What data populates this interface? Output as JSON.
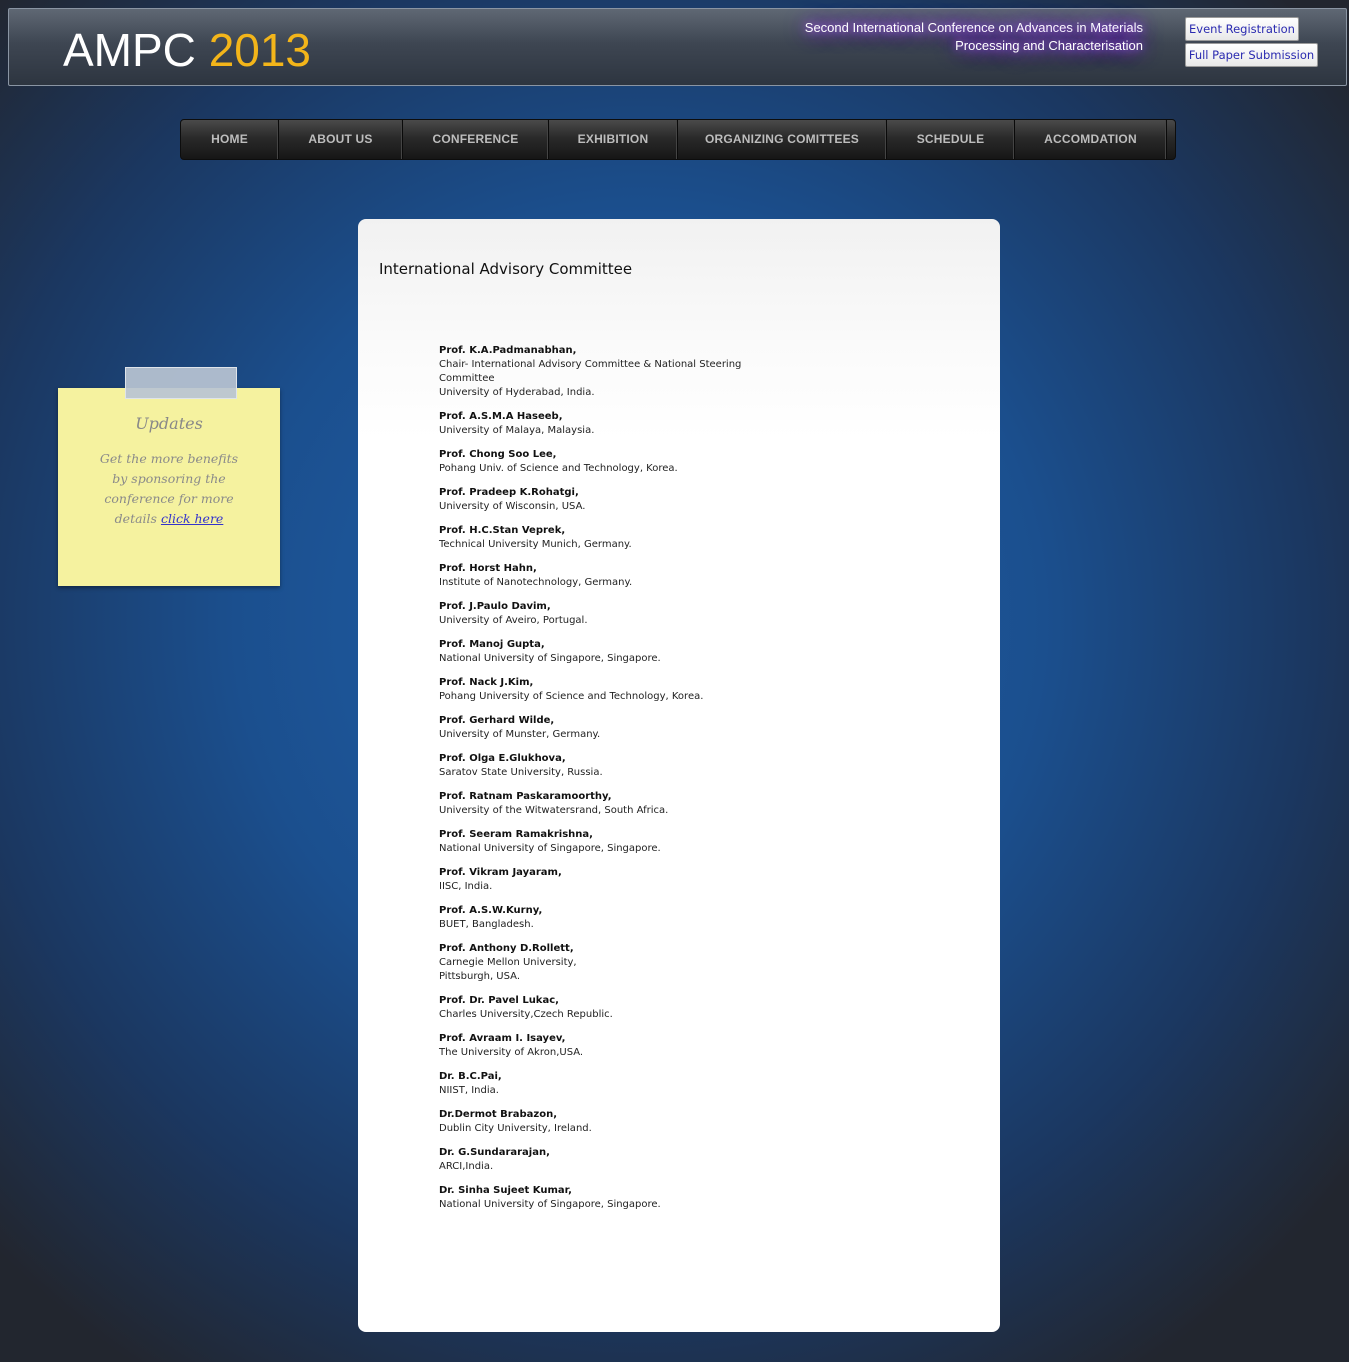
{
  "header": {
    "logo_text": "AMPC",
    "logo_year": "2013",
    "tagline_line1": "Second International Conference on Advances in Materials",
    "tagline_line2": "Processing and Characterisation",
    "buttons": {
      "event_registration": "Event Registration",
      "full_paper_submission": "Full Paper Submission"
    }
  },
  "nav": {
    "items": [
      {
        "label": "HOME"
      },
      {
        "label": "ABOUT US"
      },
      {
        "label": "CONFERENCE"
      },
      {
        "label": "EXHIBITION"
      },
      {
        "label": "ORGANIZING COMITTEES"
      },
      {
        "label": "SCHEDULE"
      },
      {
        "label": "ACCOMDATION"
      }
    ]
  },
  "updates": {
    "title": "Updates",
    "text": "Get the more benefits by sponsoring the conference for more details",
    "link_text": "click here"
  },
  "main": {
    "title": "International Advisory Committee",
    "members": [
      {
        "name": "Prof. K.A.Padmanabhan,",
        "lines": [
          "Chair- International Advisory Committee & National Steering Committee",
          "University of Hyderabad, India."
        ]
      },
      {
        "name": "Prof. A.S.M.A Haseeb,",
        "lines": [
          "University of Malaya, Malaysia."
        ]
      },
      {
        "name": "Prof. Chong Soo Lee,",
        "lines": [
          "Pohang Univ. of Science and Technology, Korea."
        ]
      },
      {
        "name": "Prof. Pradeep K.Rohatgi,",
        "lines": [
          "University of Wisconsin, USA."
        ]
      },
      {
        "name": "Prof. H.C.Stan Veprek,",
        "lines": [
          "Technical University Munich, Germany."
        ]
      },
      {
        "name": "Prof. Horst Hahn,",
        "lines": [
          "Institute of Nanotechnology, Germany."
        ]
      },
      {
        "name": "Prof. J.Paulo Davim,",
        "lines": [
          "University of Aveiro, Portugal."
        ]
      },
      {
        "name": "Prof. Manoj Gupta,",
        "lines": [
          "National University of Singapore, Singapore."
        ]
      },
      {
        "name": "Prof. Nack J.Kim,",
        "lines": [
          "Pohang University of Science and Technology, Korea."
        ]
      },
      {
        "name": "Prof. Gerhard Wilde,",
        "lines": [
          "University of Munster, Germany."
        ]
      },
      {
        "name": "Prof. Olga E.Glukhova,",
        "lines": [
          "Saratov State University, Russia."
        ]
      },
      {
        "name": "Prof. Ratnam Paskaramoorthy,",
        "lines": [
          "University of the Witwatersrand, South Africa."
        ]
      },
      {
        "name": "Prof. Seeram Ramakrishna,",
        "lines": [
          "National University of Singapore, Singapore."
        ]
      },
      {
        "name": "Prof. Vikram Jayaram,",
        "lines": [
          "IISC, India."
        ]
      },
      {
        "name": "Prof. A.S.W.Kurny,",
        "lines": [
          "BUET, Bangladesh."
        ]
      },
      {
        "name": "Prof. Anthony D.Rollett,",
        "lines": [
          "Carnegie Mellon University,",
          "Pittsburgh, USA."
        ]
      },
      {
        "name": "Prof. Dr. Pavel Lukac,",
        "lines": [
          "Charles University,Czech Republic."
        ]
      },
      {
        "name": "Prof. Avraam I. Isayev,",
        "lines": [
          "The University of Akron,USA."
        ]
      },
      {
        "name": "Dr. B.C.Pai,",
        "lines": [
          "NIIST, India."
        ]
      },
      {
        "name": "Dr.Dermot Brabazon,",
        "lines": [
          "Dublin City University, Ireland."
        ]
      },
      {
        "name": "Dr. G.Sundararajan,",
        "lines": [
          "ARCI,India."
        ]
      },
      {
        "name": "Dr. Sinha Sujeet Kumar,",
        "lines": [
          "National University of Singapore, Singapore."
        ]
      }
    ]
  },
  "colors": {
    "logo_year": "#f3b51a",
    "tagline_glow": "#b463ff",
    "note_background": "#f5f29f",
    "link": "#3333cc"
  }
}
